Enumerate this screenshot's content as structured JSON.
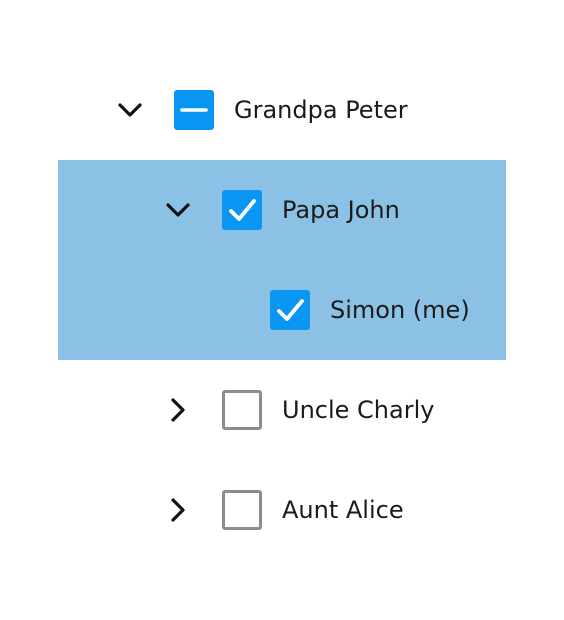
{
  "tree": {
    "nodes": [
      {
        "label": "Grandpa Peter",
        "state": "indeterminate",
        "expanded": true,
        "toggle_icon": "chevron-down-icon"
      },
      {
        "label": "Papa John",
        "state": "checked",
        "expanded": true,
        "toggle_icon": "chevron-down-icon"
      },
      {
        "label": "Simon (me)",
        "state": "checked"
      },
      {
        "label": "Uncle Charly",
        "state": "unchecked",
        "expanded": false,
        "toggle_icon": "chevron-right-icon"
      },
      {
        "label": "Aunt Alice",
        "state": "unchecked",
        "expanded": false,
        "toggle_icon": "chevron-right-icon"
      }
    ],
    "colors": {
      "accent": "#0996f3",
      "selection_highlight": "#8cc1e6",
      "unchecked_border": "#8c8c8c",
      "text": "#1b1b1b"
    }
  }
}
